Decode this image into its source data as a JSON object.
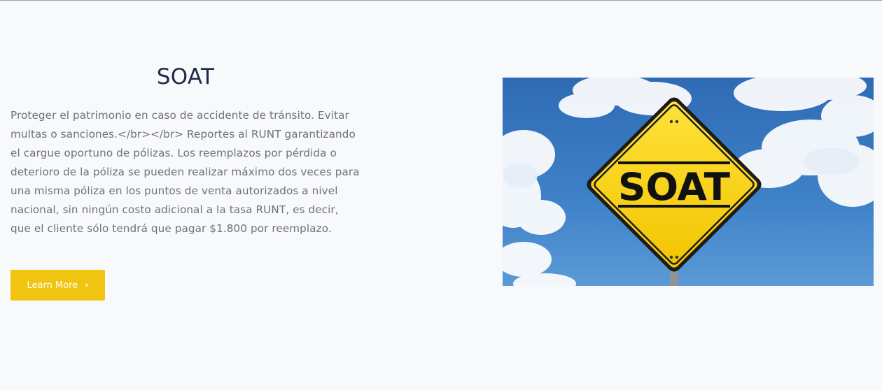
{
  "section": {
    "title": "SOAT",
    "description": "Proteger el patrimonio en caso de accidente de tránsito. Evitar multas o sanciones.</br></br> Reportes al RUNT garantizando el cargue oportuno de pólizas. Los reemplazos por pérdida o deterioro de la póliza se pueden realizar máximo dos veces para una misma póliza en los puntos de venta autorizados a nivel nacional, sin ningún costo adicional a la tasa RUNT, es decir, que el cliente sólo tendrá que pagar $1.800 por reemplazo.",
    "cta_label": "Learn More",
    "cta_icon": "chevron-right-icon"
  },
  "image": {
    "sign_text": "SOAT",
    "subject": "yellow-diamond-road-sign",
    "background": "blue-sky-with-clouds"
  },
  "colors": {
    "background": "#f8f9fb",
    "title": "#1d2a48",
    "body_text": "#6f7173",
    "button": "#f1c40f",
    "button_text": "#ffffff",
    "sign_yellow": "#f5cf0f",
    "sky": "#2f6fb8"
  }
}
